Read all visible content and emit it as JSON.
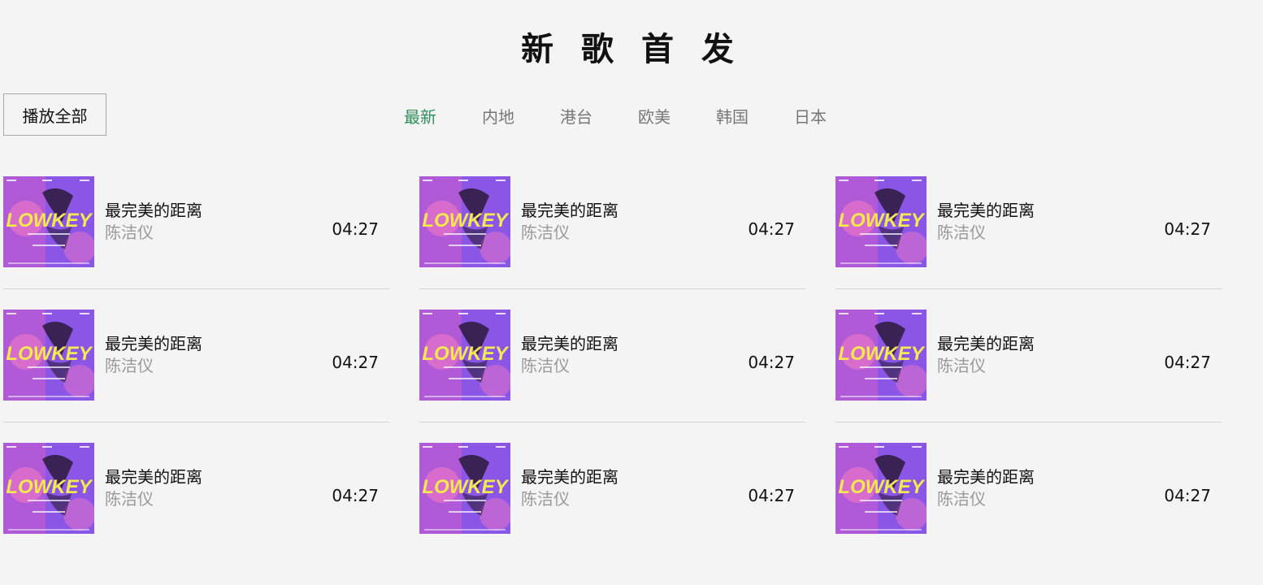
{
  "page_title": "新 歌 首 发",
  "play_all_label": "播放全部",
  "tabs": [
    {
      "label": "最新",
      "active": true
    },
    {
      "label": "内地",
      "active": false
    },
    {
      "label": "港台",
      "active": false
    },
    {
      "label": "欧美",
      "active": false
    },
    {
      "label": "韩国",
      "active": false
    },
    {
      "label": "日本",
      "active": false
    }
  ],
  "cover_art": {
    "wordmark": "LOWKEY",
    "colors": {
      "background": "#8b55e6",
      "left_panel": "#b05ad8",
      "accent_pink": "#e673c8",
      "wordmark": "#f5e94f",
      "tab_active": "#2f8f5b"
    }
  },
  "songs": [
    {
      "name": "最完美的距离",
      "artist": "陈洁仪",
      "duration": "04:27"
    },
    {
      "name": "最完美的距离",
      "artist": "陈洁仪",
      "duration": "04:27"
    },
    {
      "name": "最完美的距离",
      "artist": "陈洁仪",
      "duration": "04:27"
    },
    {
      "name": "最完美的距离",
      "artist": "陈洁仪",
      "duration": "04:27"
    },
    {
      "name": "最完美的距离",
      "artist": "陈洁仪",
      "duration": "04:27"
    },
    {
      "name": "最完美的距离",
      "artist": "陈洁仪",
      "duration": "04:27"
    },
    {
      "name": "最完美的距离",
      "artist": "陈洁仪",
      "duration": "04:27"
    },
    {
      "name": "最完美的距离",
      "artist": "陈洁仪",
      "duration": "04:27"
    },
    {
      "name": "最完美的距离",
      "artist": "陈洁仪",
      "duration": "04:27"
    }
  ]
}
